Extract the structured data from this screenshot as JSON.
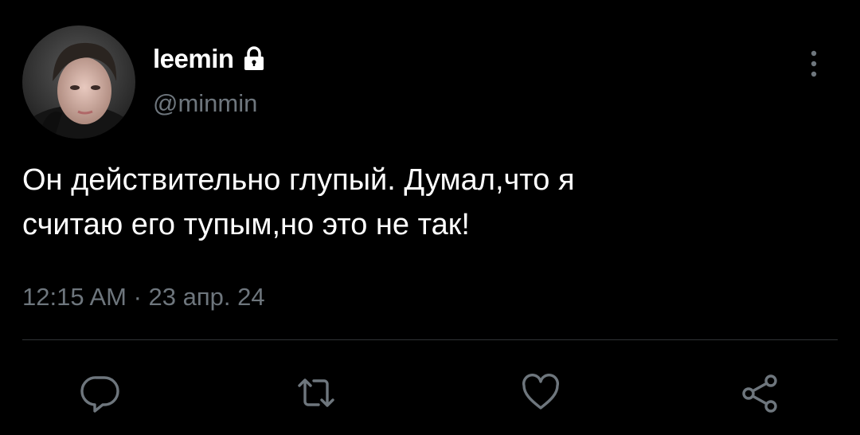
{
  "user": {
    "display_name": "leemin",
    "handle": "@minmin",
    "avatar_icon": "avatar-photo",
    "verified_icon": "lock-icon"
  },
  "tweet": {
    "text_line1": "Он действительно глупый. Думал,что я",
    "text_line2": "считаю его тупым,но это не так!",
    "timestamp": "12:15 AM · 23 апр. 24"
  },
  "actions": {
    "reply_icon": "reply-icon",
    "retweet_icon": "retweet-icon",
    "like_icon": "heart-icon",
    "share_icon": "share-icon"
  },
  "colors": {
    "background": "#000000",
    "primary_text": "#ffffff",
    "secondary_text": "#6e767d",
    "divider": "#2f3336"
  }
}
